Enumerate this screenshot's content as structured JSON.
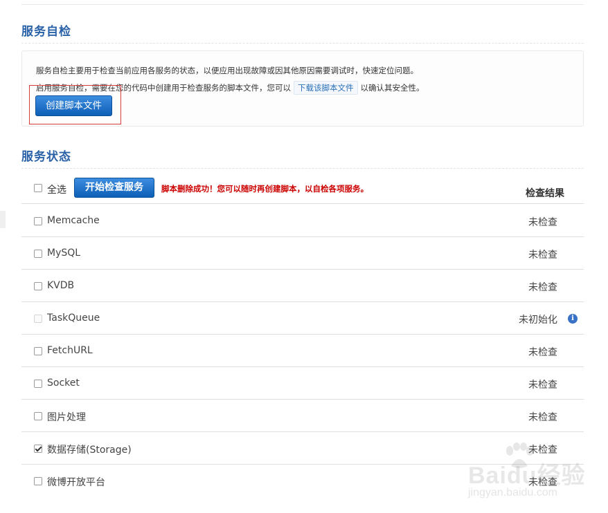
{
  "self_check": {
    "title": "服务自检",
    "desc_line1": "服务自检主要用于检查当前应用各服务的状态，以便应用出现故障或因其他原因需要调试时，快速定位问题。",
    "desc_line2_prefix": "启用服务自检，需要在您的代码中创建用于检查服务的脚本文件，您可以",
    "download_link": "下载该脚本文件",
    "desc_line2_suffix": "以确认其安全性。",
    "create_button": "创建脚本文件"
  },
  "service_status": {
    "title": "服务状态",
    "select_all": "全选",
    "start_button": "开始检查服务",
    "success_message": "脚本删除成功！您可以随时再创建脚本，以自检各项服务。",
    "result_header": "检查结果",
    "rows": [
      {
        "name": "Memcache",
        "status": "未检查",
        "checked": false,
        "disabled": false
      },
      {
        "name": "MySQL",
        "status": "未检查",
        "checked": false,
        "disabled": false
      },
      {
        "name": "KVDB",
        "status": "未检查",
        "checked": false,
        "disabled": false
      },
      {
        "name": "TaskQueue",
        "status": "未初始化",
        "checked": false,
        "disabled": true,
        "has_info_icon": true
      },
      {
        "name": "FetchURL",
        "status": "未检查",
        "checked": false,
        "disabled": false
      },
      {
        "name": "Socket",
        "status": "未检查",
        "checked": false,
        "disabled": false
      },
      {
        "name": "图片处理",
        "status": "未检查",
        "checked": false,
        "disabled": false
      },
      {
        "name": "数据存储(Storage)",
        "status": "未检查",
        "checked": true,
        "disabled": false
      },
      {
        "name": "微博开放平台",
        "status": "未检查",
        "checked": false,
        "disabled": false
      }
    ]
  },
  "watermark": {
    "brand": "Baidu经验",
    "url": "jingyan.baidu.com"
  },
  "colors": {
    "title_blue": "#2a62a8",
    "button_blue": "#0d5fb7",
    "success_red": "#cc0000",
    "highlight_outline": "#d83a3a"
  },
  "icons": {
    "info": "info-icon",
    "checkbox": "checkbox"
  }
}
